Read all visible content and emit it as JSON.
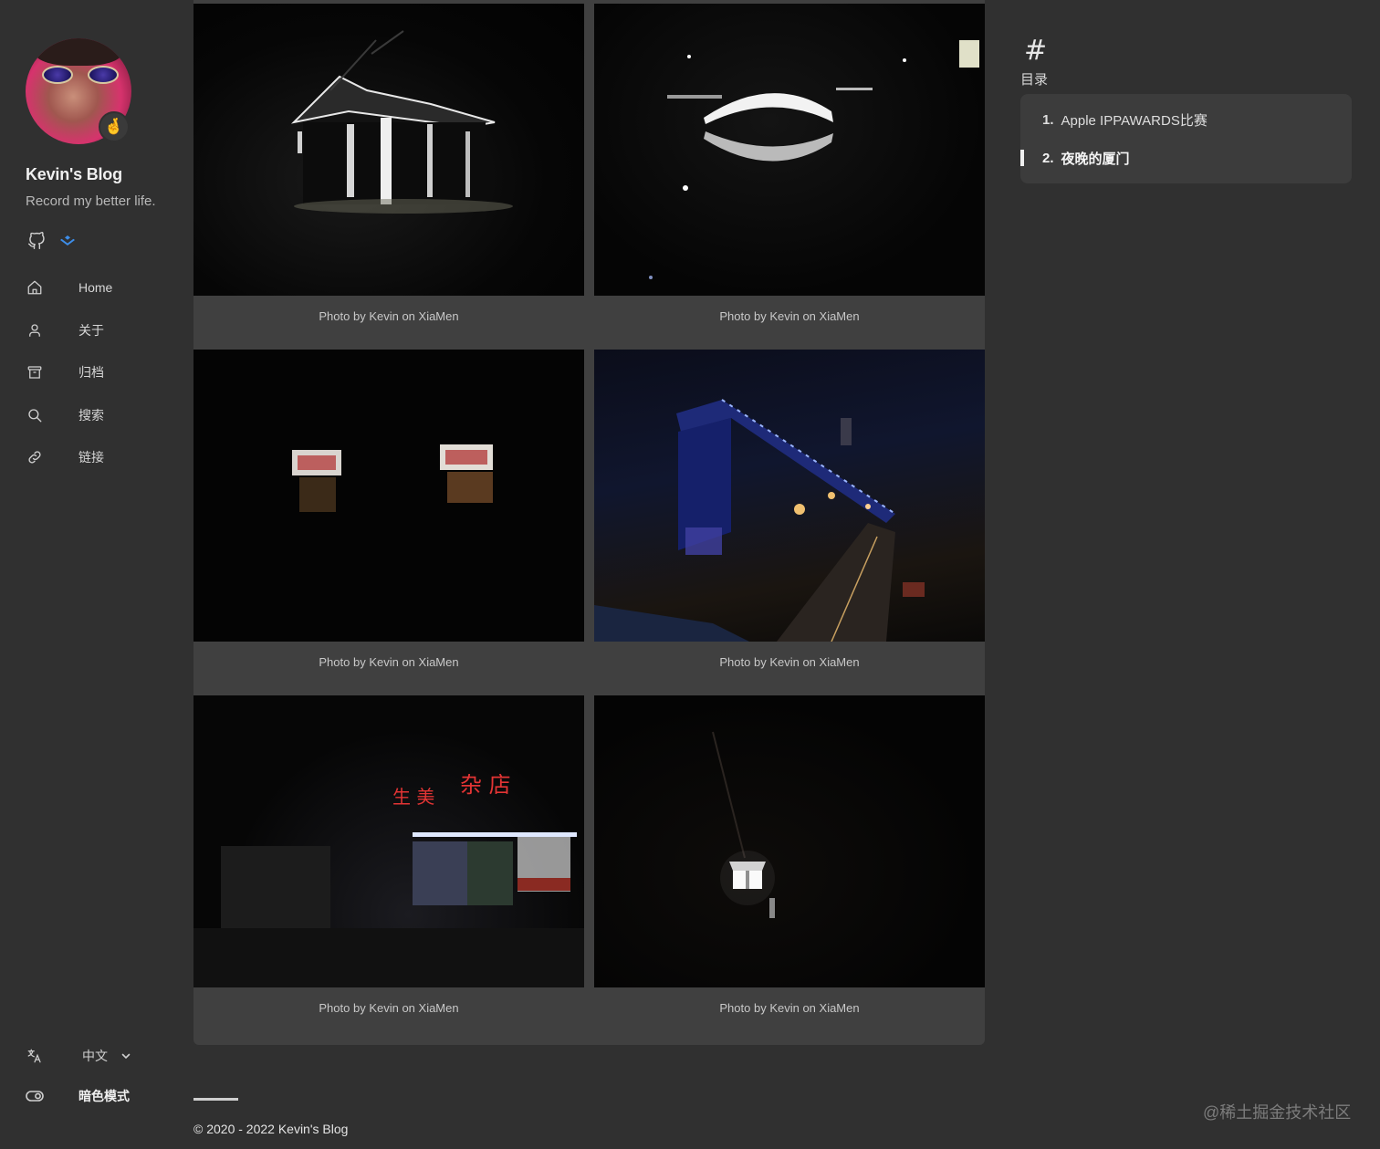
{
  "sidebar": {
    "title": "Kevin's Blog",
    "subtitle": "Record my better life.",
    "avatar_badge": "🤞",
    "social": [
      {
        "icon": "github-icon"
      },
      {
        "icon": "juejin-icon"
      }
    ],
    "nav": [
      {
        "label": "Home",
        "icon": "home-icon"
      },
      {
        "label": "关于",
        "icon": "user-icon"
      },
      {
        "label": "归档",
        "icon": "archive-icon"
      },
      {
        "label": "搜索",
        "icon": "search-icon"
      },
      {
        "label": "链接",
        "icon": "link-icon"
      }
    ],
    "language": {
      "icon": "translate-icon",
      "value": "中文"
    },
    "dark_mode": {
      "icon": "toggle-icon",
      "label": "暗色模式"
    }
  },
  "gallery": {
    "photos": [
      {
        "caption": "Photo by Kevin on XiaMen",
        "scene": "pavilion-night"
      },
      {
        "caption": "Photo by Kevin on XiaMen",
        "scene": "bridge-reflection"
      },
      {
        "caption": "Photo by Kevin on XiaMen",
        "scene": "lit-shop-windows"
      },
      {
        "caption": "Photo by Kevin on XiaMen",
        "scene": "overpass-road"
      },
      {
        "caption": "Photo by Kevin on XiaMen",
        "scene": "neon-store"
      },
      {
        "caption": "Photo by Kevin on XiaMen",
        "scene": "street-lamp"
      }
    ]
  },
  "toc": {
    "icon": "#",
    "title": "目录",
    "items": [
      {
        "num": "1.",
        "label": "Apple IPPAWARDS比赛",
        "active": false
      },
      {
        "num": "2.",
        "label": "夜晚的厦门",
        "active": true
      }
    ]
  },
  "footer": {
    "copyright": "© 2020 - 2022 Kevin's Blog",
    "watermark": "@稀土掘金技术社区"
  },
  "colors": {
    "background": "#303030",
    "panel": "#404040",
    "toc_panel": "#3c3c3c",
    "accent_blue": "#3d8eea"
  }
}
